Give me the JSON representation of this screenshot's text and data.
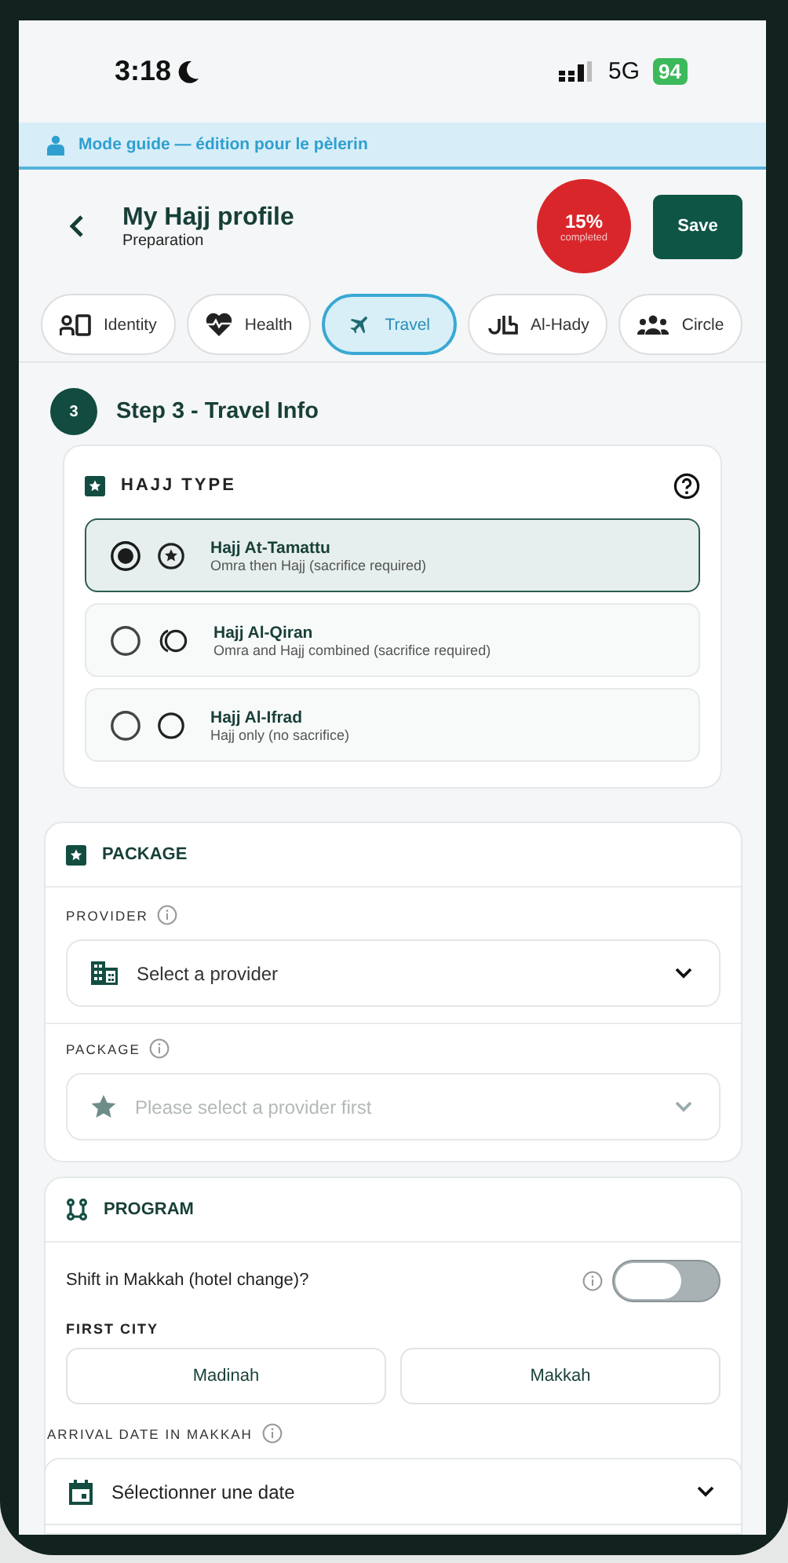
{
  "status_bar": {
    "time": "3:18",
    "network": "5G",
    "battery": "94"
  },
  "banner": {
    "text": "Mode **guide** — édition pour le pèlerin"
  },
  "header": {
    "title": "My Hajj profile",
    "subtitle": "Preparation",
    "progress": {
      "value": "15%",
      "label": "completed"
    },
    "save_button": "Save"
  },
  "tabs": [
    {
      "label": "Identity",
      "selected": false
    },
    {
      "label": "Health",
      "selected": false
    },
    {
      "label": "Travel",
      "selected": true
    },
    {
      "label": "Al-Hady",
      "selected": false
    },
    {
      "label": "Circle",
      "selected": false
    }
  ],
  "step": {
    "number": "3",
    "title": "Step 3 - Travel Info"
  },
  "hajj_type": {
    "title": "HAJJ TYPE",
    "options": [
      {
        "title": "Hajj At-Tamattu",
        "description": "Omra then Hajj (sacrifice required)",
        "selected": true
      },
      {
        "title": "Hajj Al-Qiran",
        "description": "Omra and Hajj combined (sacrifice required)",
        "selected": false
      },
      {
        "title": "Hajj Al-Ifrad",
        "description": "Hajj only (no sacrifice)",
        "selected": false
      }
    ]
  },
  "package": {
    "title": "PACKAGE",
    "fields": [
      {
        "label": "PROVIDER",
        "placeholder": "Select a provider",
        "disabled": false
      },
      {
        "label": "PACKAGE",
        "placeholder": "Please select a provider first",
        "disabled": true
      }
    ]
  },
  "program": {
    "title": "PROGRAM",
    "shift": {
      "label": "Shift in Makkah (hotel change)?",
      "on": false
    },
    "first_city": {
      "label": "FIRST CITY",
      "options": [
        {
          "label": "Madinah",
          "selected": false
        },
        {
          "label": "Makkah",
          "selected": false
        }
      ]
    },
    "arrival": {
      "label": "ARRIVAL DATE IN MAKKAH",
      "placeholder": "Sélectionner une date"
    }
  }
}
